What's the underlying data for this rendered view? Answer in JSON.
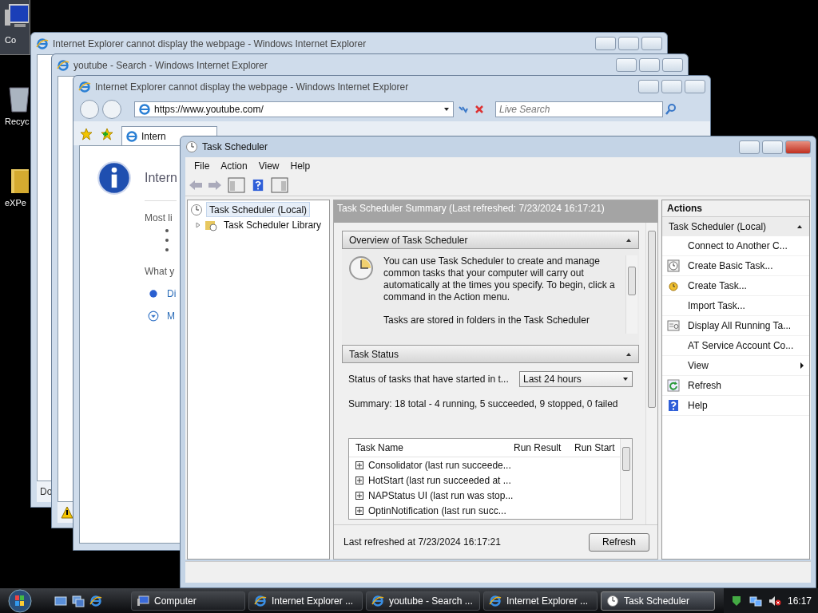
{
  "desktop": {
    "icons": [
      {
        "label": "Co",
        "kind": "computer",
        "selected": true
      },
      {
        "label": "Recyc",
        "kind": "recycle-bin",
        "selected": false
      },
      {
        "label": "eXPe",
        "kind": "folder",
        "selected": false
      }
    ]
  },
  "browser_back": {
    "title": "Internet Explorer cannot display the webpage - Windows Internet Explorer",
    "status": "Do"
  },
  "browser_middle": {
    "title": "youtube - Search - Windows Internet Explorer"
  },
  "browser_front": {
    "title": "Internet Explorer cannot display the webpage - Windows Internet Explorer",
    "address": "https://www.youtube.com/",
    "search": {
      "placeholder": "Live Search"
    },
    "tab": "Intern",
    "page": {
      "heading": "Intern",
      "intro": "Most li",
      "question": "What y",
      "options": [
        {
          "label": "Di",
          "kind": "bullet"
        },
        {
          "label": "M",
          "kind": "expand"
        }
      ]
    }
  },
  "task_scheduler": {
    "title": "Task Scheduler",
    "menu": [
      "File",
      "Action",
      "View",
      "Help"
    ],
    "tree": [
      {
        "label": "Task Scheduler (Local)",
        "selected": true,
        "children": [
          {
            "label": "Task Scheduler Library",
            "selected": false,
            "expanded": false
          }
        ]
      }
    ],
    "summary": {
      "header": "Task Scheduler Summary (Last refreshed: 7/23/2024 16:17:21)",
      "overview": {
        "title": "Overview of Task Scheduler",
        "expanded": true,
        "paragraphs": [
          "You can use Task Scheduler to create and manage common tasks that your computer will carry out automatically at the times you specify. To begin, click a command in the Action menu.",
          "Tasks are stored in folders in the Task Scheduler"
        ]
      },
      "task_status": {
        "title": "Task Status",
        "expanded": true,
        "filter_label": "Status of tasks that have started in t...",
        "filter_value": "Last 24 hours",
        "summary": "Summary: 18 total - 4 running, 5 succeeded, 9 stopped, 0 failed",
        "table": {
          "columns": [
            "Task Name",
            "Run Result",
            "Run Start"
          ],
          "rows": [
            {
              "name": "Consolidator (last run succeede...",
              "expanded": false
            },
            {
              "name": "HotStart (last run succeeded at ...",
              "expanded": false
            },
            {
              "name": "NAPStatus UI (last run was stop...",
              "expanded": false
            },
            {
              "name": "OptinNotification (last run succ...",
              "expanded": false
            }
          ]
        }
      },
      "last_refreshed": "Last refreshed at 7/23/2024 16:17:21",
      "refresh_button": "Refresh"
    },
    "actions": {
      "title": "Actions",
      "group": {
        "label": "Task Scheduler (Local)",
        "expanded": true
      },
      "items": [
        {
          "label": "Connect to Another C...",
          "kind": "plain",
          "submenu": false
        },
        {
          "label": "Create Basic Task...",
          "kind": "basic-task",
          "submenu": false
        },
        {
          "label": "Create Task...",
          "kind": "create-task",
          "submenu": false
        },
        {
          "label": "Import Task...",
          "kind": "plain",
          "submenu": false
        },
        {
          "label": "Display All Running Ta...",
          "kind": "running",
          "submenu": false
        },
        {
          "label": "AT Service Account Co...",
          "kind": "plain",
          "submenu": false
        },
        {
          "label": "View",
          "kind": "plain",
          "submenu": true
        },
        {
          "label": "Refresh",
          "kind": "refresh",
          "submenu": false
        },
        {
          "label": "Help",
          "kind": "help",
          "submenu": false
        }
      ]
    }
  },
  "taskbar": {
    "buttons": [
      {
        "label": "Computer",
        "kind": "computer",
        "selected": false
      },
      {
        "label": "Internet Explorer ...",
        "kind": "browser",
        "selected": false
      },
      {
        "label": "youtube - Search ...",
        "kind": "browser",
        "selected": false
      },
      {
        "label": "Internet Explorer ...",
        "kind": "browser",
        "selected": false
      },
      {
        "label": "Task Scheduler",
        "kind": "clock",
        "selected": true
      }
    ],
    "clock": "16:17"
  }
}
